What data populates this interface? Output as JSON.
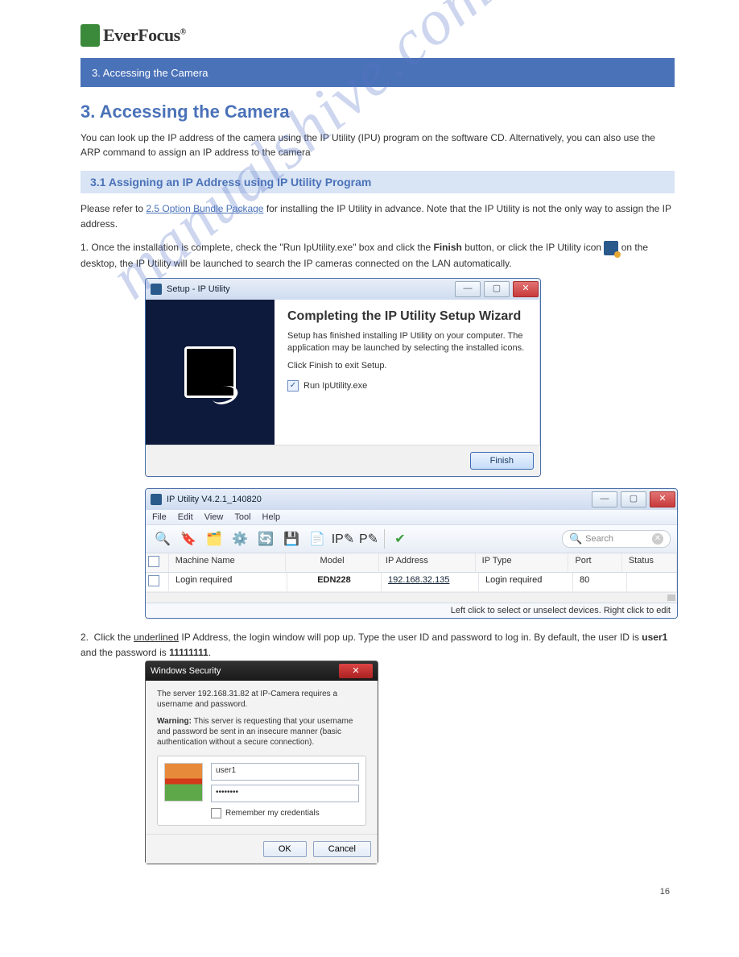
{
  "watermark": "manualshive.com",
  "logo": {
    "text": "EverFocus",
    "registered": "®"
  },
  "banner": "3.   Accessing the Camera",
  "chapter": {
    "title": "3. Accessing the Camera"
  },
  "intro": "You can look up the IP address of the camera using the IP Utility (IPU) program on the software CD. Alternatively, you can also use the ARP command to assign an IP address to the camera",
  "section_band": "3.1  Assigning an IP Address using IP Utility Program",
  "para_intro": "Please refer to 2.5 Option Bundle Package for installing the IP Utility in advance. Note that the IP Utility is not the only way to assign the IP address.",
  "link_text": "2.5 Option Bundle Package",
  "steps": {
    "s1a": "1.  Once the installation is complete, check the \"Run IpUtility.exe\" box and click the ",
    "s1b": "Finish",
    "s1c": " button, or click the IP Utility icon ",
    "s1d": " on the desktop, the IP Utility will be launched to search the IP cameras connected on the LAN automatically."
  },
  "setup_window": {
    "title": "Setup - IP Utility",
    "heading": "Completing the IP Utility Setup Wizard",
    "p1": "Setup has finished installing IP Utility on your computer. The application may be launched by selecting the installed icons.",
    "p2": "Click Finish to exit Setup.",
    "checkbox": "Run IpUtility.exe",
    "button": "Finish"
  },
  "iputil_window": {
    "title": "IP Utility V4.2.1_140820",
    "menu": [
      "File",
      "Edit",
      "View",
      "Tool",
      "Help"
    ],
    "search_placeholder": "Search",
    "headers": {
      "machine": "Machine Name",
      "model": "Model",
      "ip": "IP Address",
      "iptype": "IP Type",
      "port": "Port",
      "status": "Status"
    },
    "row": {
      "machine": "Login required",
      "model": "EDN228",
      "ip": "192.168.32.135",
      "iptype": "Login required",
      "port": "80"
    },
    "statusbar": "Left click to select or unselect devices. Right click to edit"
  },
  "step2": "2.  Click the underlined IP Address, the login window will pop up. Type the user ID and password to log in. By default, the user ID is user1 and the password is 11111111.",
  "security": {
    "title": "Windows Security",
    "msg": "The server 192.168.31.82 at IP-Camera requires a username and password.",
    "warn_bold": "Warning:",
    "warn": " This server is requesting that your username and password be sent in an insecure manner (basic authentication without a secure connection).",
    "user": "user1",
    "pass": "••••••••",
    "remember": "Remember my credentials",
    "ok": "OK",
    "cancel": "Cancel"
  },
  "page_number": "16"
}
